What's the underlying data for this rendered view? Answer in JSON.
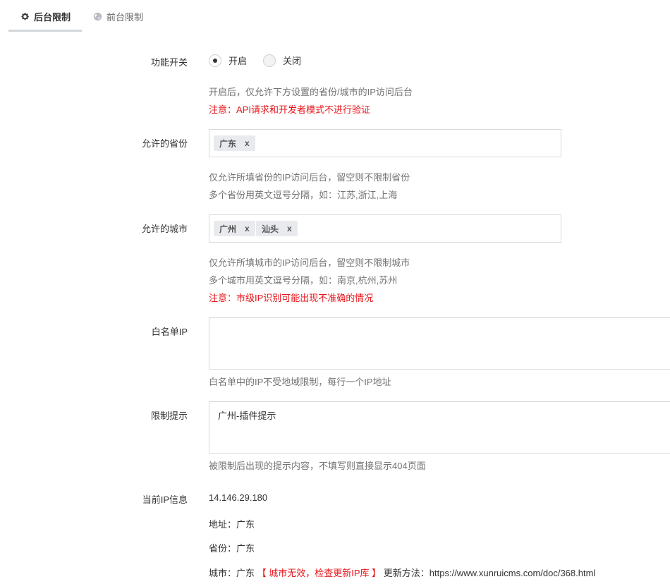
{
  "tabs": [
    {
      "label": "后台限制",
      "icon": "gear-icon",
      "active": true
    },
    {
      "label": "前台限制",
      "icon": "globe-icon",
      "active": false
    }
  ],
  "form": {
    "switch": {
      "label": "功能开关",
      "options": [
        {
          "label": "开启",
          "selected": true
        },
        {
          "label": "关闭",
          "selected": false
        }
      ],
      "help": "开启后，仅允许下方设置的省份/城市的IP访问后台",
      "warning": "注意：API请求和开发者模式不进行验证"
    },
    "provinces": {
      "label": "允许的省份",
      "tags": [
        "广东"
      ],
      "help1": "仅允许所填省份的IP访问后台，留空则不限制省份",
      "help2": "多个省份用英文逗号分隔，如：江苏,浙江,上海"
    },
    "cities": {
      "label": "允许的城市",
      "tags": [
        "广州",
        "汕头"
      ],
      "help1": "仅允许所填城市的IP访问后台，留空则不限制城市",
      "help2": "多个城市用英文逗号分隔，如：南京,杭州,苏州",
      "warning": "注意：市级IP识别可能出现不准确的情况"
    },
    "whitelist": {
      "label": "白名单IP",
      "value": "",
      "help": "白名单中的IP不受地域限制，每行一个IP地址"
    },
    "tip": {
      "label": "限制提示",
      "value": "广州-插件提示",
      "help": "被限制后出现的提示内容，不填写则直接显示404页面"
    },
    "ipinfo": {
      "label": "当前IP信息",
      "ip": "14.146.29.180",
      "address": "地址：广东",
      "province": "省份：广东",
      "city": "城市：广东",
      "city_invalid": "【 城市无效，检查更新IP库 】",
      "update_method": "更新方法：https://www.xunruicms.com/doc/368.html"
    }
  },
  "colors": {
    "warning": "#e7141a",
    "help": "#737373",
    "tab_underline": "#d3d6da"
  },
  "tag_close": "x"
}
